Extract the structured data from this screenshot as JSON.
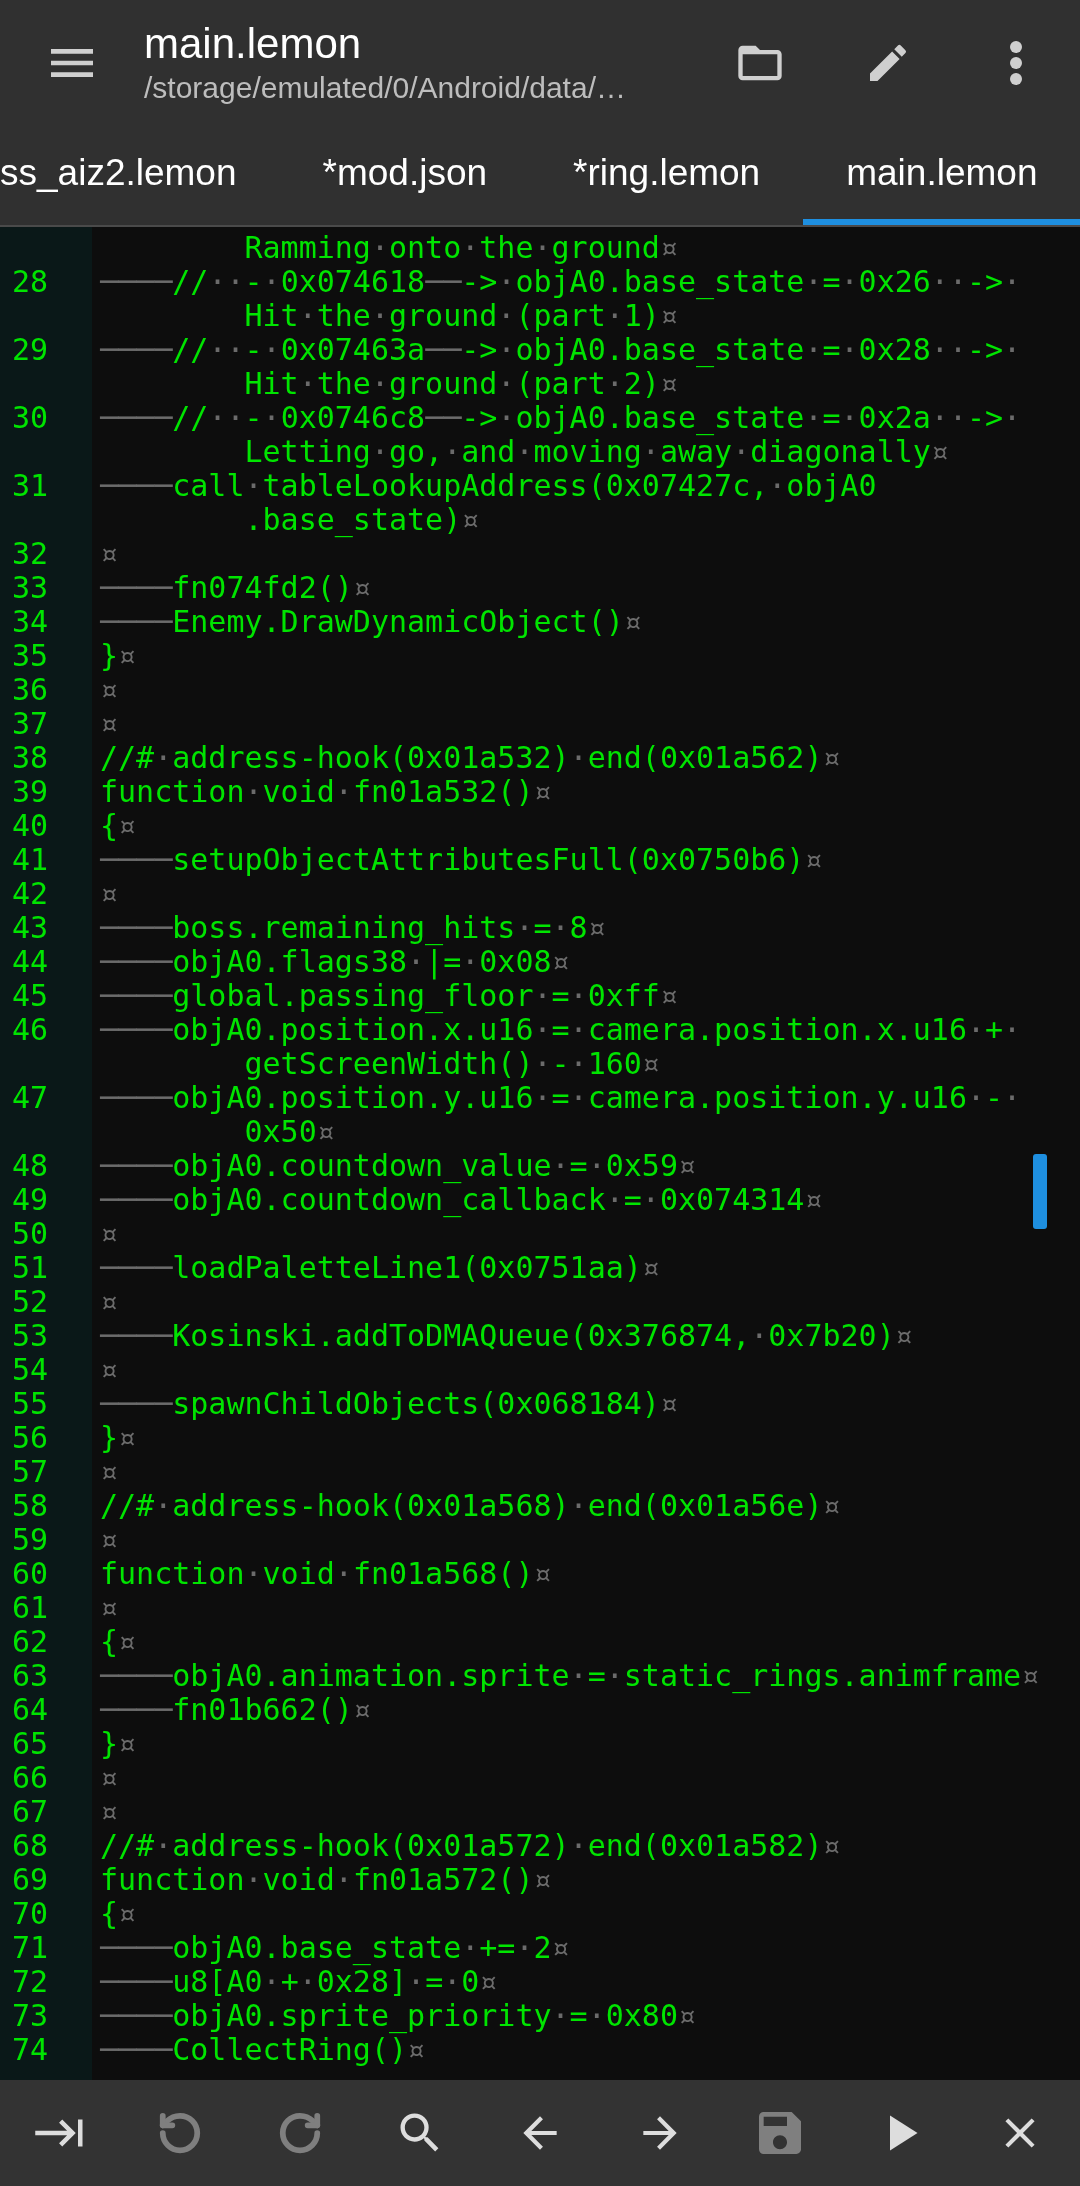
{
  "app_bar": {
    "title": "main.lemon",
    "path": "/storage/emulated/0/Android/data/…",
    "actions": [
      {
        "kind": "folder"
      },
      {
        "kind": "edit"
      },
      {
        "kind": "more"
      }
    ]
  },
  "tabs": [
    {
      "label": "ss_aiz2.lemon",
      "selected": false
    },
    {
      "label": "*mod.json",
      "selected": false
    },
    {
      "label": "*ring.lemon",
      "selected": false
    },
    {
      "label": "main.lemon",
      "selected": true
    }
  ],
  "editor": {
    "rows": [
      {
        "text": "Ramming·onto·the·ground¤"
      },
      {
        "number": "28",
        "text": "────//··-·0x074618──->·objA0.base_state·=·0x26··->·"
      },
      {
        "text": "Hit·the·ground·(part·1)¤"
      },
      {
        "number": "29",
        "text": "────//··-·0x07463a──->·objA0.base_state·=·0x28··->·"
      },
      {
        "text": "Hit·the·ground·(part·2)¤"
      },
      {
        "number": "30",
        "text": "────//··-·0x0746c8──->·objA0.base_state·=·0x2a··->·"
      },
      {
        "text": "Letting·go,·and·moving·away·diagonally¤"
      },
      {
        "number": "31",
        "text": "────call·tableLookupAddress(0x07427c,·objA0"
      },
      {
        "text": ".base_state)¤"
      },
      {
        "number": "32",
        "text": "¤"
      },
      {
        "number": "33",
        "text": "────fn074fd2()¤"
      },
      {
        "number": "34",
        "text": "────Enemy.DrawDynamicObject()¤"
      },
      {
        "number": "35",
        "text": "}¤"
      },
      {
        "number": "36",
        "text": "¤"
      },
      {
        "number": "37",
        "text": "¤"
      },
      {
        "number": "38",
        "text": "//#·address-hook(0x01a532)·end(0x01a562)¤"
      },
      {
        "number": "39",
        "text": "function·void·fn01a532()¤"
      },
      {
        "number": "40",
        "text": "{¤"
      },
      {
        "number": "41",
        "text": "────setupObjectAttributesFull(0x0750b6)¤"
      },
      {
        "number": "42",
        "text": "¤"
      },
      {
        "number": "43",
        "text": "────boss.remaining_hits·=·8¤"
      },
      {
        "number": "44",
        "text": "────objA0.flags38·|=·0x08¤"
      },
      {
        "number": "45",
        "text": "────global.passing_floor·=·0xff¤"
      },
      {
        "number": "46",
        "text": "────objA0.position.x.u16·=·camera.position.x.u16·+·"
      },
      {
        "text": "getScreenWidth()·-·160¤"
      },
      {
        "number": "47",
        "text": "────objA0.position.y.u16·=·camera.position.y.u16·-·"
      },
      {
        "text": "0x50¤"
      },
      {
        "number": "48",
        "text": "────objA0.countdown_value·=·0x59¤"
      },
      {
        "number": "49",
        "text": "────objA0.countdown_callback·=·0x074314¤"
      },
      {
        "number": "50",
        "text": "¤"
      },
      {
        "number": "51",
        "text": "────loadPaletteLine1(0x0751aa)¤"
      },
      {
        "number": "52",
        "text": "¤"
      },
      {
        "number": "53",
        "text": "────Kosinski.addToDMAQueue(0x376874,·0x7b20)¤"
      },
      {
        "number": "54",
        "text": "¤"
      },
      {
        "number": "55",
        "text": "────spawnChildObjects(0x068184)¤"
      },
      {
        "number": "56",
        "text": "}¤"
      },
      {
        "number": "57",
        "text": "¤"
      },
      {
        "number": "58",
        "text": "//#·address-hook(0x01a568)·end(0x01a56e)¤"
      },
      {
        "number": "59",
        "text": "¤"
      },
      {
        "number": "60",
        "text": "function·void·fn01a568()¤"
      },
      {
        "number": "61",
        "text": "¤"
      },
      {
        "number": "62",
        "text": "{¤"
      },
      {
        "number": "63",
        "text": "────objA0.animation.sprite·=·static_rings.animframe¤"
      },
      {
        "number": "64",
        "text": "────fn01b662()¤"
      },
      {
        "number": "65",
        "text": "}¤"
      },
      {
        "number": "66",
        "text": "¤"
      },
      {
        "number": "67",
        "text": "¤"
      },
      {
        "number": "68",
        "text": "//#·address-hook(0x01a572)·end(0x01a582)¤"
      },
      {
        "number": "69",
        "text": "function·void·fn01a572()¤"
      },
      {
        "number": "70",
        "text": "{¤"
      },
      {
        "number": "71",
        "text": "────objA0.base_state·+=·2¤"
      },
      {
        "number": "72",
        "text": "────u8[A0·+·0x28]·=·0¤"
      },
      {
        "number": "73",
        "text": "────objA0.sprite_priority·=·0x80¤"
      },
      {
        "number": "74",
        "text": "────CollectRing()¤"
      }
    ]
  },
  "toolbar": [
    {
      "kind": "indent",
      "disabled": false
    },
    {
      "kind": "undo",
      "disabled": true
    },
    {
      "kind": "redo",
      "disabled": true
    },
    {
      "kind": "search",
      "disabled": false
    },
    {
      "kind": "back",
      "disabled": false
    },
    {
      "kind": "forward",
      "disabled": false
    },
    {
      "kind": "save",
      "disabled": true
    },
    {
      "kind": "run",
      "disabled": false
    },
    {
      "kind": "close",
      "disabled": false
    }
  ]
}
